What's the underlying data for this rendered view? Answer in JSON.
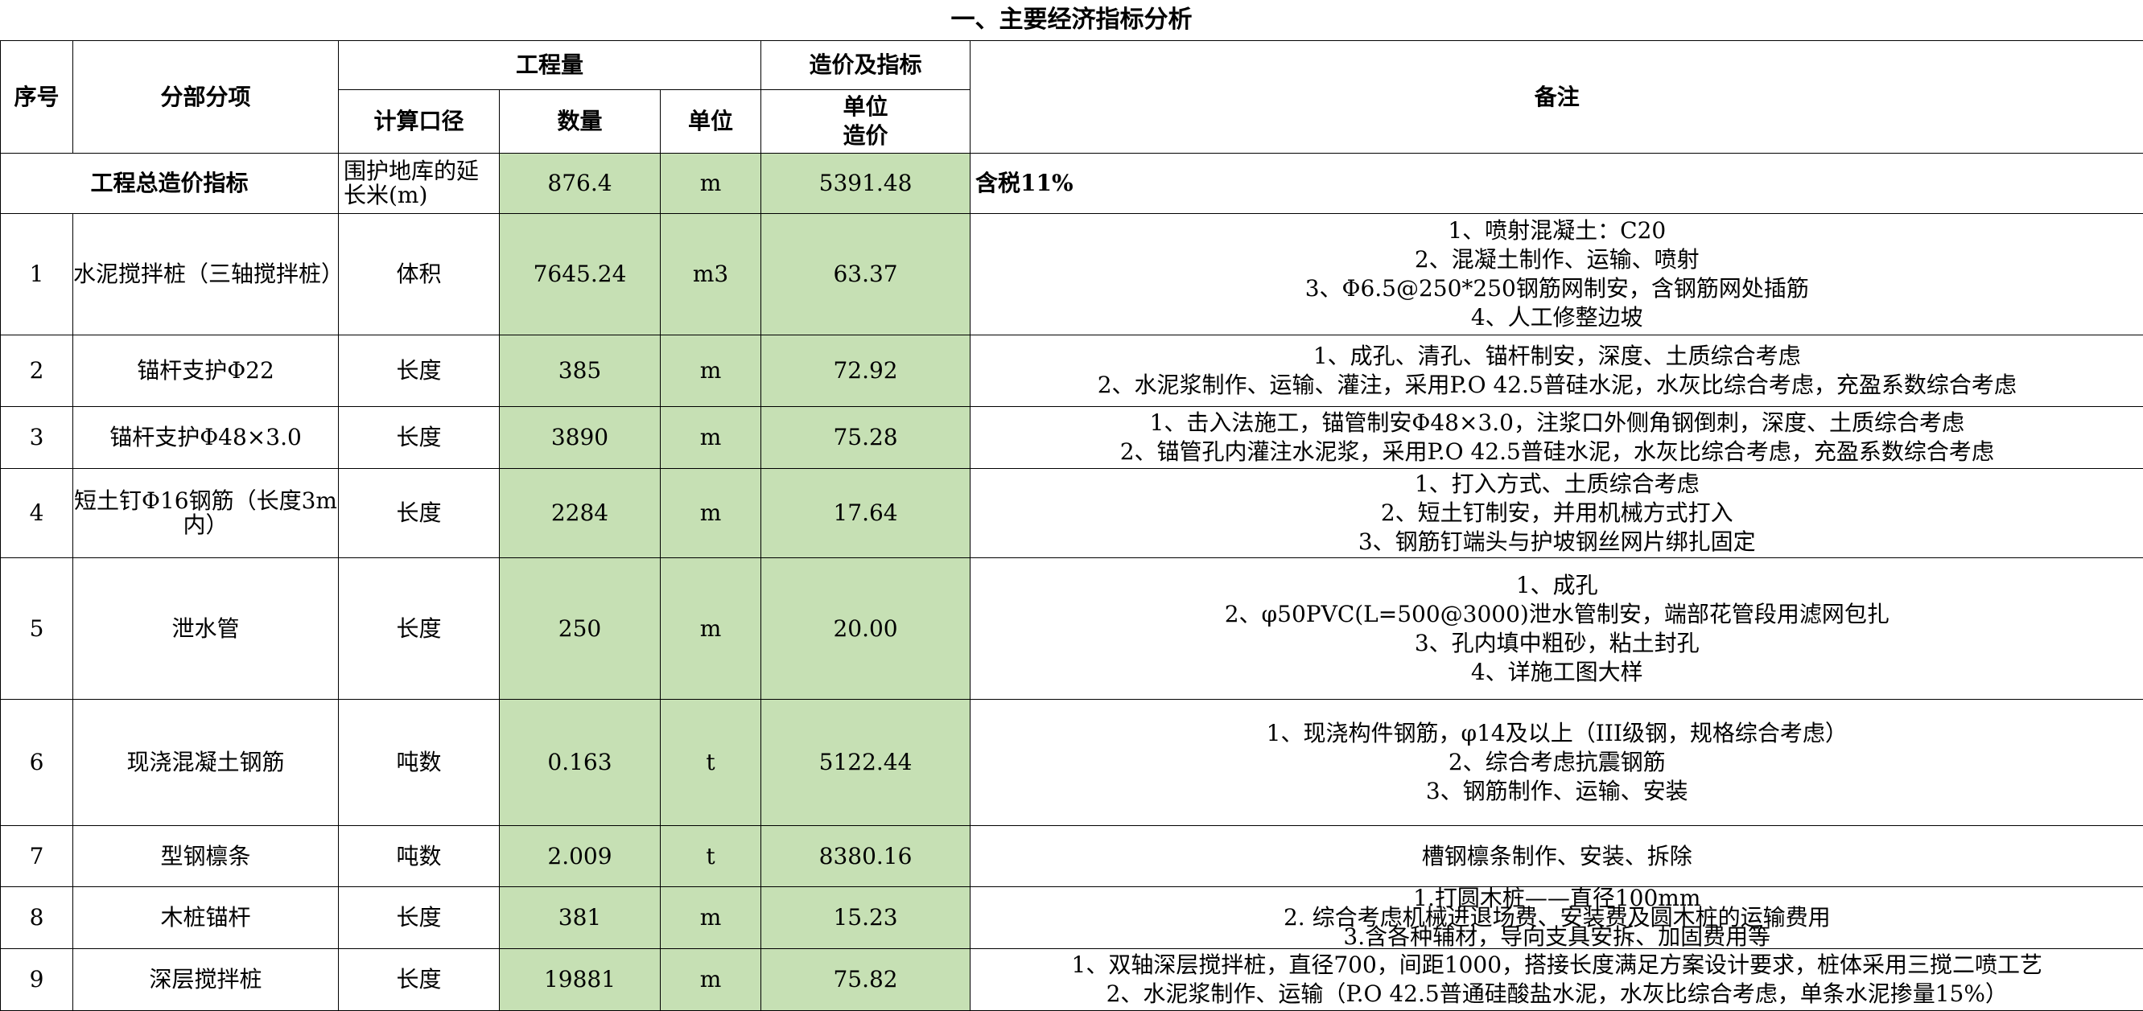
{
  "title": "一、主要经济指标分析",
  "headers": {
    "seq": "序号",
    "item": "分部分项",
    "quantity_group": "工程量",
    "cost_group": "造价及指标",
    "basis": "计算口径",
    "qty": "数量",
    "unit": "单位",
    "unit_price": "单位\n造价",
    "remarks": "备注"
  },
  "summary": {
    "label": "工程总造价指标",
    "basis": "围护地库的延长米(m)",
    "qty": "876.4",
    "unit": "m",
    "price": "5391.48",
    "remark": "含税11%"
  },
  "rows": [
    {
      "seq": "1",
      "item": "水泥搅拌桩（三轴搅拌桩）",
      "basis": "体积",
      "qty": "7645.24",
      "unit": "m3",
      "price": "63.37",
      "notes": [
        "1、喷射混凝土：C20",
        "2、混凝土制作、运输、喷射",
        "3、Φ6.5@250*250钢筋网制安，含钢筋网处插筋",
        "4、人工修整边坡"
      ]
    },
    {
      "seq": "2",
      "item": "锚杆支护Φ22",
      "basis": "长度",
      "qty": "385",
      "unit": "m",
      "price": "72.92",
      "notes": [
        "1、成孔、清孔、锚杆制安，深度、土质综合考虑",
        "2、水泥浆制作、运输、灌注，采用P.O 42.5普硅水泥，水灰比综合考虑，充盈系数综合考虑"
      ]
    },
    {
      "seq": "3",
      "item": "锚杆支护Φ48×3.0",
      "basis": "长度",
      "qty": "3890",
      "unit": "m",
      "price": "75.28",
      "notes": [
        "1、击入法施工，锚管制安Φ48×3.0，注浆口外侧角钢倒刺，深度、土质综合考虑",
        "2、锚管孔内灌注水泥浆，采用P.O 42.5普硅水泥，水灰比综合考虑，充盈系数综合考虑"
      ]
    },
    {
      "seq": "4",
      "item": "短土钉Φ16钢筋（长度3m内）",
      "basis": "长度",
      "qty": "2284",
      "unit": "m",
      "price": "17.64",
      "notes": [
        "1、打入方式、土质综合考虑",
        "2、短土钉制安，并用机械方式打入",
        "3、钢筋钉端头与护坡钢丝网片绑扎固定"
      ]
    },
    {
      "seq": "5",
      "item": "泄水管",
      "basis": "长度",
      "qty": "250",
      "unit": "m",
      "price": "20.00",
      "notes": [
        "1、成孔",
        "2、φ50PVC(L=500@3000)泄水管制安，端部花管段用滤网包扎",
        "3、孔内填中粗砂，粘土封孔",
        "4、详施工图大样"
      ]
    },
    {
      "seq": "6",
      "item": "现浇混凝土钢筋",
      "basis": "吨数",
      "qty": "0.163",
      "unit": "t",
      "price": "5122.44",
      "notes": [
        "1、现浇构件钢筋，φ14及以上（III级钢，规格综合考虑）",
        "2、综合考虑抗震钢筋",
        "3、钢筋制作、运输、安装"
      ]
    },
    {
      "seq": "7",
      "item": "型钢檩条",
      "basis": "吨数",
      "qty": "2.009",
      "unit": "t",
      "price": "8380.16",
      "notes": [
        "槽钢檩条制作、安装、拆除"
      ]
    },
    {
      "seq": "8",
      "item": "木桩锚杆",
      "basis": "长度",
      "qty": "381",
      "unit": "m",
      "price": "15.23",
      "notes": [
        "1.打圆木桩——直径100mm",
        "2. 综合考虑机械进退场费、安装费及圆木桩的运输费用",
        "3.含各种辅材，导向支具安拆、加固费用等"
      ]
    },
    {
      "seq": "9",
      "item": "深层搅拌桩",
      "basis": "长度",
      "qty": "19881",
      "unit": "m",
      "price": "75.82",
      "notes": [
        "1、双轴深层搅拌桩，直径700，间距1000，搭接长度满足方案设计要求，桩体采用三搅二喷工艺",
        "2、水泥浆制作、运输（P.O 42.5普通硅酸盐水泥，水灰比综合考虑，单条水泥掺量15%）"
      ]
    }
  ],
  "colors": {
    "highlight": "#c6e0b4",
    "border": "#000000"
  }
}
